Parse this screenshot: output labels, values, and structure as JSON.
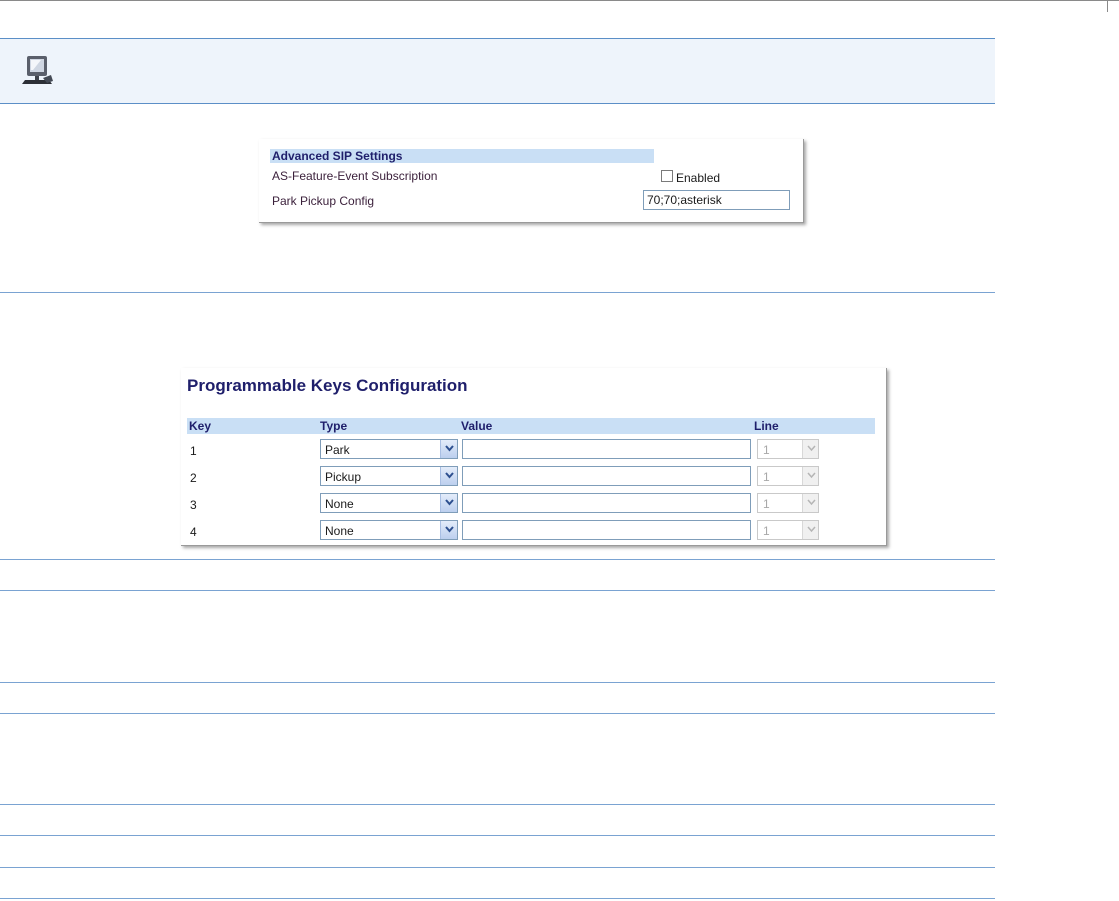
{
  "advanced_sip": {
    "title": "Advanced SIP Settings",
    "as_feature_label": "AS-Feature-Event Subscription",
    "as_feature_checkbox_label": "Enabled",
    "as_feature_checked": false,
    "park_pickup_label": "Park Pickup Config",
    "park_pickup_value": "70;70;asterisk"
  },
  "programmable_keys": {
    "title": "Programmable Keys Configuration",
    "columns": [
      "Key",
      "Type",
      "Value",
      "Line"
    ],
    "rows": [
      {
        "key": "1",
        "type": "Park",
        "value": "",
        "line": "1"
      },
      {
        "key": "2",
        "type": "Pickup",
        "value": "",
        "line": "1"
      },
      {
        "key": "3",
        "type": "None",
        "value": "",
        "line": "1"
      },
      {
        "key": "4",
        "type": "None",
        "value": "",
        "line": "1"
      }
    ]
  },
  "icons": {
    "header": "computer-icon",
    "dropdown": "chevron-down-icon"
  },
  "colors": {
    "header_bg": "#eef4fb",
    "rule": "#7aa3d2",
    "section_head_bg": "#c9dff5",
    "heading_text": "#1f1f6b"
  }
}
